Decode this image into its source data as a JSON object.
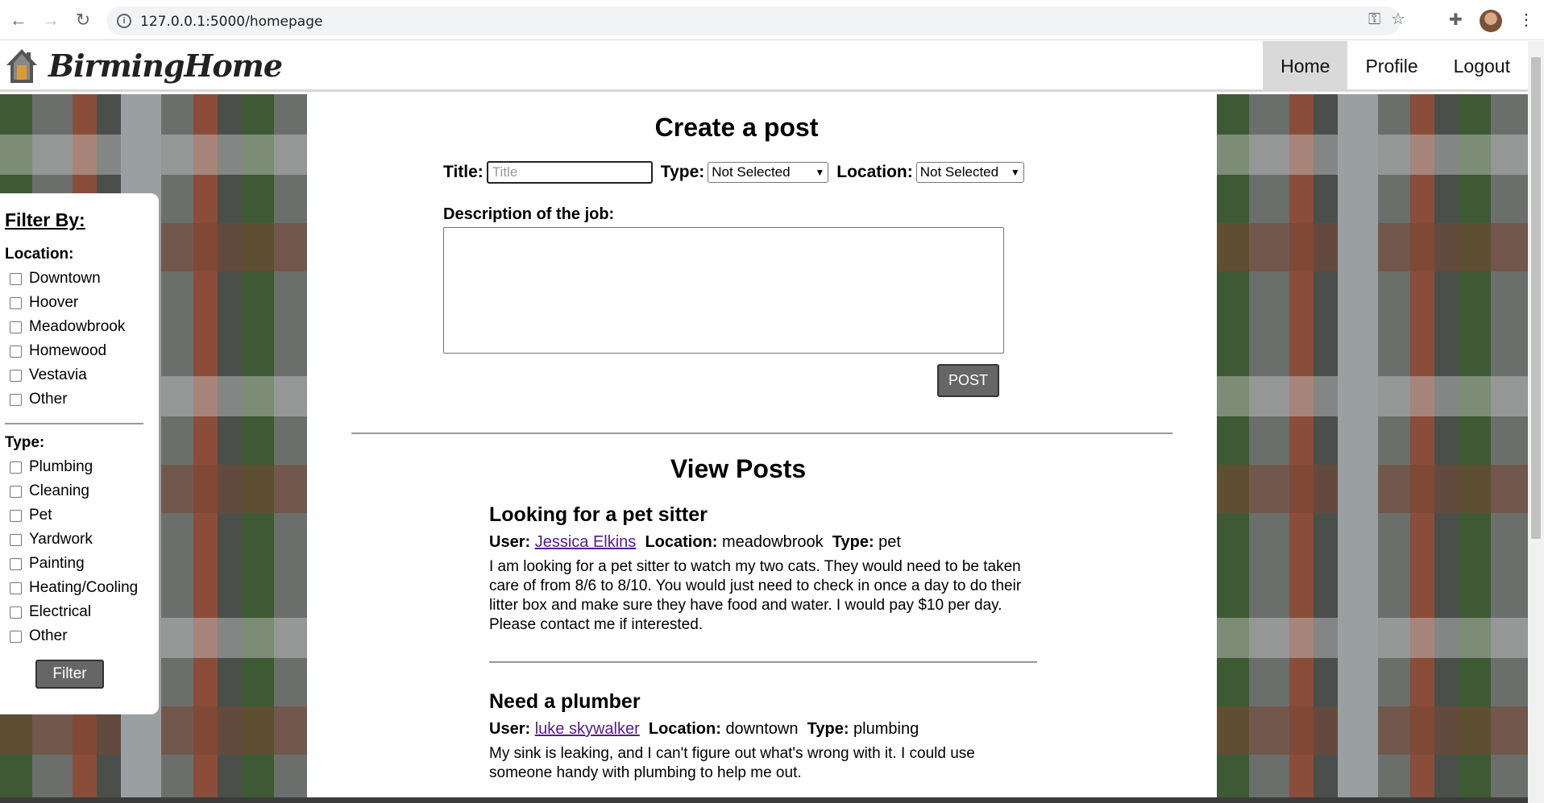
{
  "browser": {
    "url": "127.0.0.1:5000/homepage",
    "back_icon": "←",
    "forward_icon": "→",
    "reload_icon": "↻",
    "info_icon": "i",
    "key_icon": "⚿",
    "star_icon": "☆",
    "extensions_icon": "✚",
    "menu_icon": "⋮"
  },
  "header": {
    "brand": "BirmingHome",
    "nav": [
      "Home",
      "Profile",
      "Logout"
    ]
  },
  "filter": {
    "heading": "Filter By:",
    "location_label": "Location:",
    "locations": [
      "Downtown",
      "Hoover",
      "Meadowbrook",
      "Homewood",
      "Vestavia",
      "Other"
    ],
    "type_label": "Type:",
    "types": [
      "Plumbing",
      "Cleaning",
      "Pet",
      "Yardwork",
      "Painting",
      "Heating/Cooling",
      "Electrical",
      "Other"
    ],
    "button": "Filter"
  },
  "create": {
    "heading": "Create a post",
    "title_label": "Title:",
    "title_placeholder": "Title",
    "type_label": "Type:",
    "type_value": "Not Selected",
    "location_label": "Location:",
    "location_value": "Not Selected",
    "desc_label": "Description of the job:",
    "post_button": "POST"
  },
  "view": {
    "heading": "View Posts",
    "posts": [
      {
        "title": "Looking for a pet sitter",
        "user_label": "User:",
        "user": "Jessica Elkins",
        "location_label": "Location:",
        "location": "meadowbrook",
        "type_label": "Type:",
        "type": "pet",
        "body": "I am looking for a pet sitter to watch my two cats. They would need to be taken care of from 8/6 to 8/10. You would just need to check in once a day to do their litter box and make sure they have food and water. I would pay $10 per day. Please contact me if interested."
      },
      {
        "title": "Need a plumber",
        "user_label": "User:",
        "user": "luke skywalker",
        "location_label": "Location:",
        "location": "downtown",
        "type_label": "Type:",
        "type": "plumbing",
        "body": "My sink is leaking, and I can't figure out what's wrong with it. I could use someone handy with plumbing to help me out."
      }
    ]
  }
}
